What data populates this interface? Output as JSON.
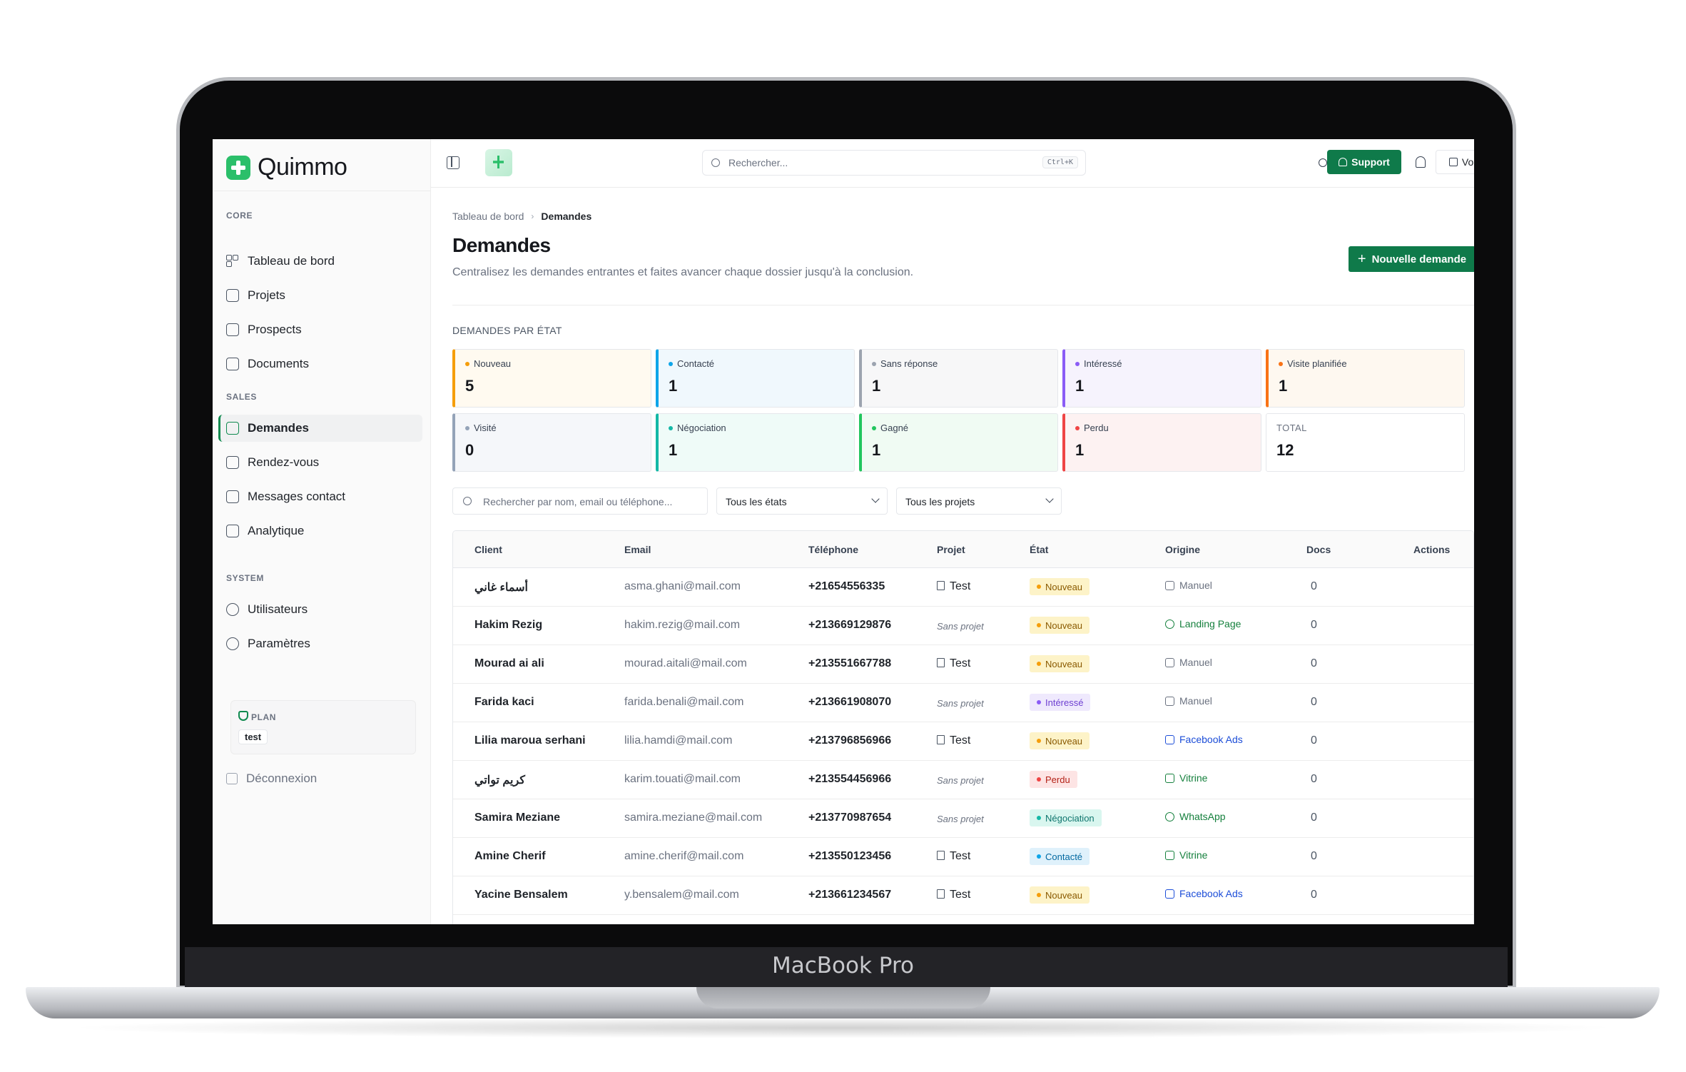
{
  "device": {
    "label": "MacBook Pro"
  },
  "app": {
    "name": "Quimmo"
  },
  "sidebar": {
    "sections": [
      {
        "title": "CORE",
        "items": [
          {
            "label": "Tableau de bord",
            "icon": "grid-icon"
          },
          {
            "label": "Projets",
            "icon": "building-icon"
          },
          {
            "label": "Prospects",
            "icon": "user-card-icon"
          },
          {
            "label": "Documents",
            "icon": "document-icon"
          }
        ]
      },
      {
        "title": "SALES",
        "items": [
          {
            "label": "Demandes",
            "icon": "clipboard-icon",
            "active": true
          },
          {
            "label": "Rendez-vous",
            "icon": "calendar-icon"
          },
          {
            "label": "Messages contact",
            "icon": "mail-icon"
          },
          {
            "label": "Analytique",
            "icon": "chart-icon"
          }
        ]
      },
      {
        "title": "SYSTEM",
        "items": [
          {
            "label": "Utilisateurs",
            "icon": "users-icon"
          },
          {
            "label": "Paramètres",
            "icon": "gear-icon"
          }
        ]
      }
    ],
    "plan": {
      "label": "PLAN",
      "value": "test"
    },
    "logout_label": "Déconnexion"
  },
  "topbar": {
    "search_placeholder": "Rechercher...",
    "shortcut": "Ctrl+K",
    "support_label": "Support",
    "vitrine_label": "Voir la vitrine"
  },
  "breadcrumb": {
    "root": "Tableau de bord",
    "current": "Demandes"
  },
  "page": {
    "title": "Demandes",
    "subtitle": "Centralisez les demandes entrantes et faites avancer chaque dossier jusqu'à la conclusion.",
    "new_button": "Nouvelle demande"
  },
  "states": {
    "title": "DEMANDES PAR ÉTAT",
    "cards": [
      {
        "label": "Nouveau",
        "value": "5",
        "color": "#f59e0b",
        "bg": "#fffaf0"
      },
      {
        "label": "Contacté",
        "value": "1",
        "color": "#0ea5e9",
        "bg": "#f0f8fd"
      },
      {
        "label": "Sans réponse",
        "value": "1",
        "color": "#9ca3af",
        "bg": "#f7f7f8"
      },
      {
        "label": "Intéressé",
        "value": "1",
        "color": "#8b5cf6",
        "bg": "#f6f3fd"
      },
      {
        "label": "Visite planifiée",
        "value": "1",
        "color": "#f97316",
        "bg": "#fef8f0"
      },
      {
        "label": "Visité",
        "value": "0",
        "color": "#94a3b8",
        "bg": "#f5f7fa"
      },
      {
        "label": "Négociation",
        "value": "1",
        "color": "#14b8a6",
        "bg": "#effbf8"
      },
      {
        "label": "Gagné",
        "value": "1",
        "color": "#22c55e",
        "bg": "#f0fbf3"
      },
      {
        "label": "Perdu",
        "value": "1",
        "color": "#ef4444",
        "bg": "#fdf2f2"
      }
    ],
    "total": {
      "label": "TOTAL",
      "value": "12"
    }
  },
  "filters": {
    "search_placeholder": "Rechercher par nom, email ou téléphone...",
    "state_select": "Tous les états",
    "project_select": "Tous les projets"
  },
  "table": {
    "columns": [
      "Client",
      "Email",
      "Téléphone",
      "Projet",
      "État",
      "Origine",
      "Docs",
      "Actions"
    ],
    "rows": [
      {
        "client": "أسماء غاني",
        "email": "asma.ghani@mail.com",
        "phone": "+21654556335",
        "project": "Test",
        "state": "Nouveau",
        "origin": "Manuel",
        "docs": "0"
      },
      {
        "client": "Hakim Rezig",
        "email": "hakim.rezig@mail.com",
        "phone": "+213669129876",
        "project": "Sans projet",
        "state": "Nouveau",
        "origin": "Landing Page",
        "docs": "0"
      },
      {
        "client": "Mourad ai ali",
        "email": "mourad.aitali@mail.com",
        "phone": "+213551667788",
        "project": "Test",
        "state": "Nouveau",
        "origin": "Manuel",
        "docs": "0"
      },
      {
        "client": "Farida kaci",
        "email": "farida.benali@mail.com",
        "phone": "+213661908070",
        "project": "Sans projet",
        "state": "Intéressé",
        "origin": "Manuel",
        "docs": "0"
      },
      {
        "client": "Lilia maroua serhani",
        "email": "lilia.hamdi@mail.com",
        "phone": "+213796856966",
        "project": "Test",
        "state": "Nouveau",
        "origin": "Facebook Ads",
        "docs": "0"
      },
      {
        "client": "كريم تواتي",
        "email": "karim.touati@mail.com",
        "phone": "+213554456966",
        "project": "Sans projet",
        "state": "Perdu",
        "origin": "Vitrine",
        "docs": "0"
      },
      {
        "client": "Samira Meziane",
        "email": "samira.meziane@mail.com",
        "phone": "+213770987654",
        "project": "Sans projet",
        "state": "Négociation",
        "origin": "WhatsApp",
        "docs": "0"
      },
      {
        "client": "Amine Cherif",
        "email": "amine.cherif@mail.com",
        "phone": "+213550123456",
        "project": "Test",
        "state": "Contacté",
        "origin": "Vitrine",
        "docs": "0"
      },
      {
        "client": "Yacine Bensalem",
        "email": "y.bensalem@mail.com",
        "phone": "+213661234567",
        "project": "Test",
        "state": "Nouveau",
        "origin": "Facebook Ads",
        "docs": "0"
      }
    ]
  },
  "badge_colors": {
    "Nouveau": {
      "bg": "#fdf3c8",
      "fg": "#8a5a00",
      "dot": "#f59e0b"
    },
    "Intéressé": {
      "bg": "#efe9fd",
      "fg": "#6d3fd1",
      "dot": "#8b5cf6"
    },
    "Perdu": {
      "bg": "#fde4e4",
      "fg": "#b42318",
      "dot": "#ef4444"
    },
    "Négociation": {
      "bg": "#d9f6ef",
      "fg": "#0f766e",
      "dot": "#14b8a6"
    },
    "Contacté": {
      "bg": "#dff1fb",
      "fg": "#0369a1",
      "dot": "#0ea5e9"
    }
  },
  "origin_colors": {
    "Manuel": "#6b7280",
    "Landing Page": "#15803d",
    "Facebook Ads": "#1d4ed8",
    "Vitrine": "#15803d",
    "WhatsApp": "#15803d"
  }
}
